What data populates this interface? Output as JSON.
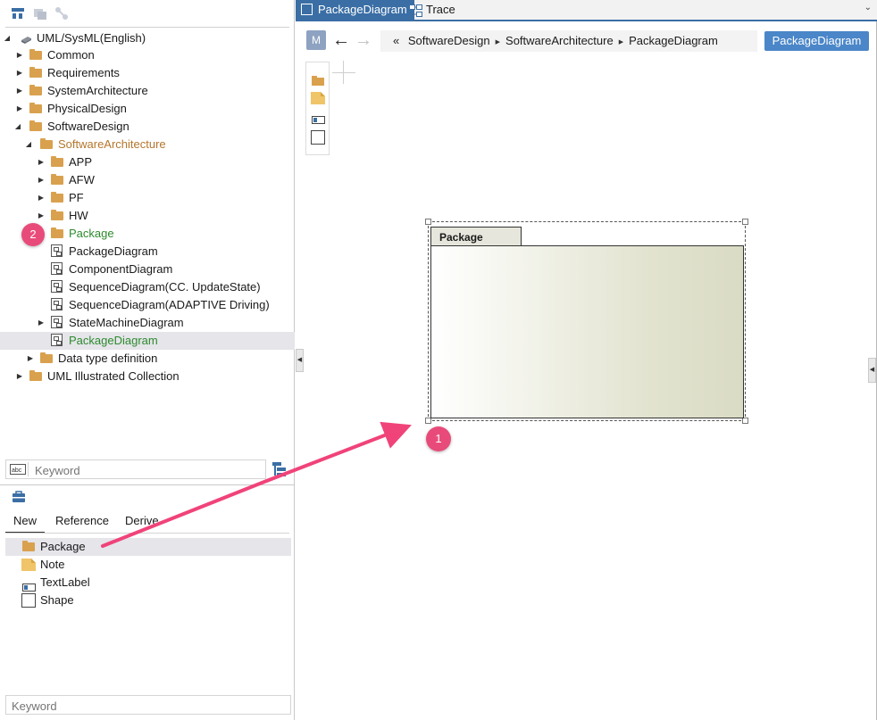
{
  "tree": {
    "items": [
      {
        "label": "UML/SysML(English)"
      },
      {
        "label": "Common"
      },
      {
        "label": "Requirements"
      },
      {
        "label": "SystemArchitecture"
      },
      {
        "label": "PhysicalDesign"
      },
      {
        "label": "SoftwareDesign"
      },
      {
        "label": "SoftwareArchitecture"
      },
      {
        "label": "APP"
      },
      {
        "label": "AFW"
      },
      {
        "label": "PF"
      },
      {
        "label": "HW"
      },
      {
        "label": "Package"
      },
      {
        "label": "PackageDiagram"
      },
      {
        "label": "ComponentDiagram"
      },
      {
        "label": "SequenceDiagram(CC. UpdateState)"
      },
      {
        "label": "SequenceDiagram(ADAPTIVE Driving)"
      },
      {
        "label": "StateMachineDiagram"
      },
      {
        "label": "PackageDiagram"
      },
      {
        "label": "Data type definition"
      },
      {
        "label": "UML Illustrated Collection"
      }
    ],
    "search_placeholder": "Keyword"
  },
  "badges": {
    "one": "1",
    "two": "2"
  },
  "new_panel": {
    "tabs": [
      "New",
      "Reference",
      "Derive"
    ],
    "items": [
      {
        "label": "Package",
        "icon": "folder-icon"
      },
      {
        "label": "Note",
        "icon": "note-icon"
      },
      {
        "label": "TextLabel",
        "icon": "text-label-icon"
      },
      {
        "label": "Shape",
        "icon": "shape-icon"
      }
    ],
    "search_placeholder": "Keyword"
  },
  "editor": {
    "tabs": [
      {
        "label": "PackageDiagram",
        "active": true
      },
      {
        "label": "Trace",
        "active": false
      }
    ],
    "mode_button": "M",
    "breadcrumb_prefix": "«",
    "breadcrumb": [
      "SoftwareDesign",
      "SoftwareArchitecture",
      "PackageDiagram"
    ],
    "diagram_name_button": "PackageDiagram",
    "package_element": {
      "name": "Package"
    }
  },
  "colors": {
    "accent_tab": "#3a6ea5",
    "badge": "#e84b7a",
    "folder": "#d9a14e",
    "highlight_green": "#2e8a2e",
    "highlight_brown": "#b5762c",
    "diagram_button": "#4a86c8"
  }
}
